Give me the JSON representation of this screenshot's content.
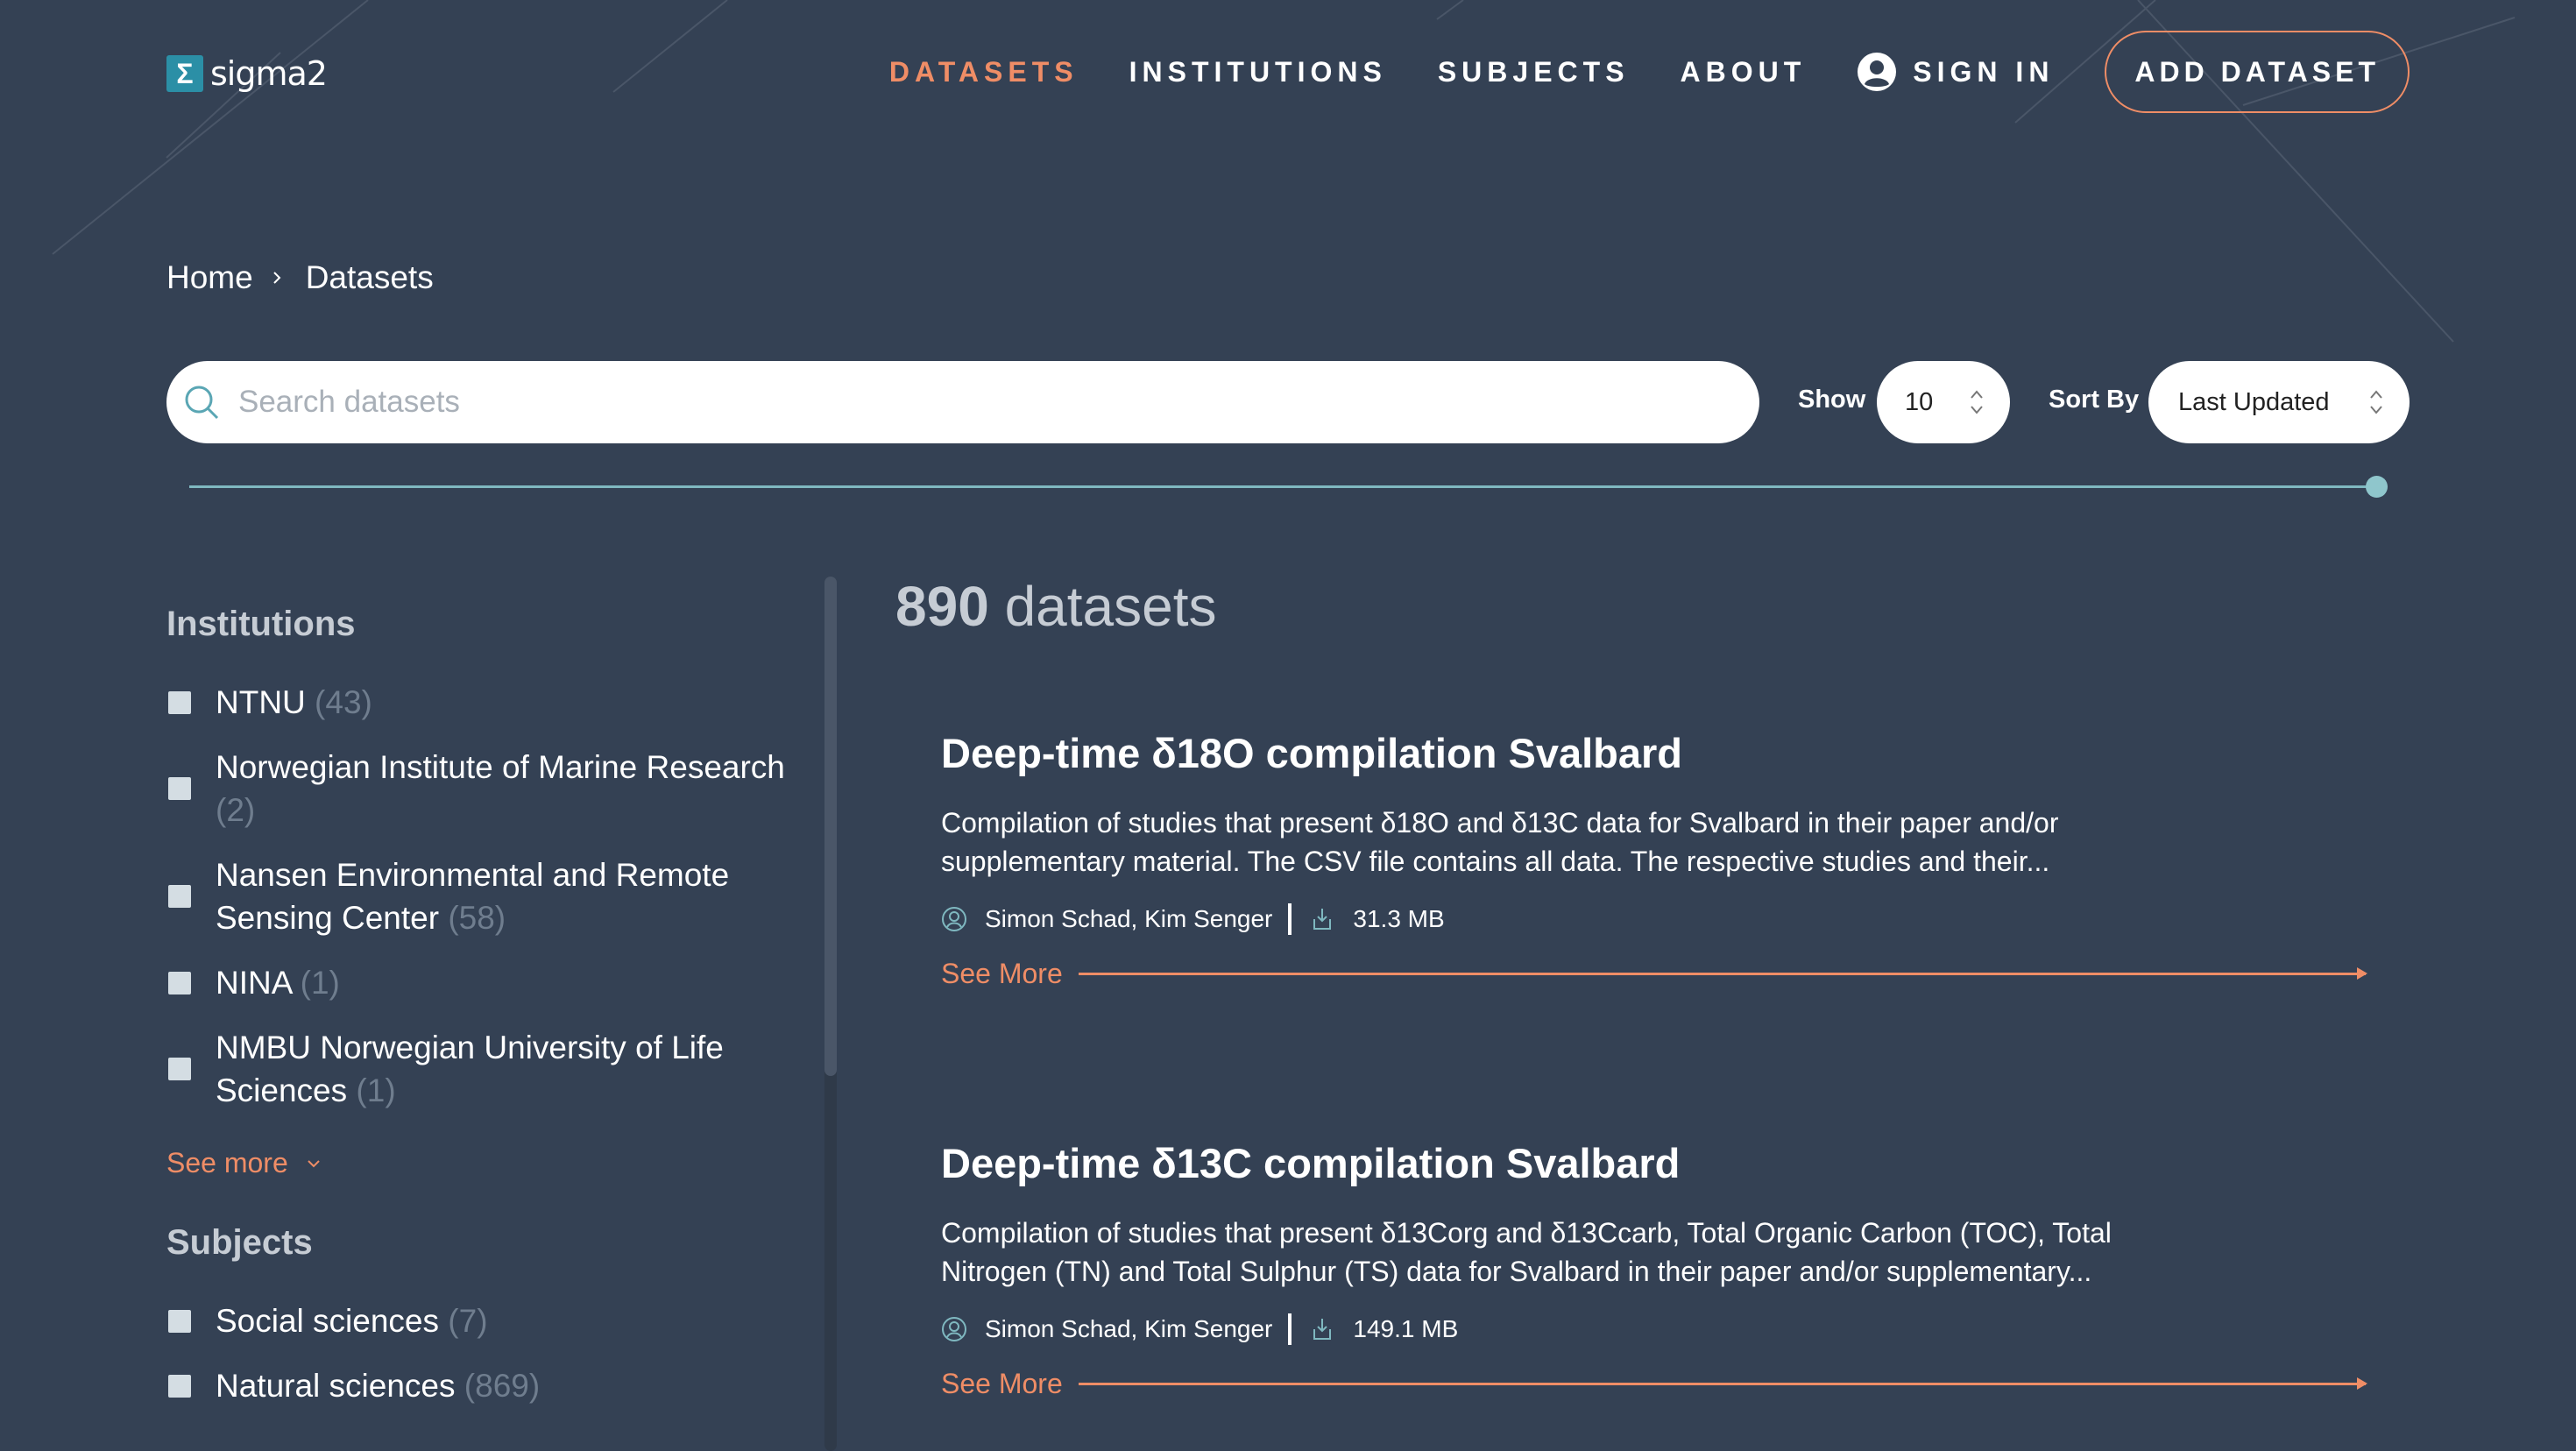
{
  "brand": {
    "logo_glyph": "Σ",
    "name": "sigma2"
  },
  "nav": {
    "items": [
      {
        "label": "DATASETS",
        "active": true
      },
      {
        "label": "INSTITUTIONS"
      },
      {
        "label": "SUBJECTS"
      },
      {
        "label": "ABOUT"
      },
      {
        "label": "SIGN IN",
        "icon": "user-circle-icon"
      }
    ],
    "cta_label": "ADD DATASET"
  },
  "breadcrumb": {
    "home": "Home",
    "current": "Datasets"
  },
  "search": {
    "placeholder": "Search datasets",
    "value": ""
  },
  "show": {
    "label": "Show",
    "value": "10"
  },
  "sort": {
    "label": "Sort By",
    "value": "Last Updated"
  },
  "sidebar": {
    "institutions": {
      "title": "Institutions",
      "items": [
        {
          "label": "NTNU",
          "count": "(43)"
        },
        {
          "label": "Norwegian Institute of Marine Research",
          "count": "(2)"
        },
        {
          "label": "Nansen Environmental and Remote Sensing Center",
          "count": "(58)"
        },
        {
          "label": "NINA",
          "count": "(1)"
        },
        {
          "label": "NMBU Norwegian University of Life Sciences",
          "count": "(1)"
        }
      ],
      "see_more": "See more"
    },
    "subjects": {
      "title": "Subjects",
      "items": [
        {
          "label": "Social sciences",
          "count": "(7)"
        },
        {
          "label": "Natural sciences",
          "count": "(869)"
        }
      ]
    }
  },
  "results": {
    "count": "890",
    "unit": "datasets"
  },
  "datasets": [
    {
      "title": "Deep-time δ18O compilation Svalbard",
      "description": "Compilation of studies that present δ18O and δ13C data for Svalbard in their paper and/or supplementary material. The CSV file contains all data. The respective studies and their...",
      "authors": "Simon Schad, Kim Senger",
      "size": "31.3 MB",
      "see_more": "See More"
    },
    {
      "title": "Deep-time δ13C compilation Svalbard",
      "description": "Compilation of studies that present δ13Corg and δ13Ccarb, Total Organic Carbon (TOC), Total Nitrogen (TN) and Total Sulphur (TS) data for Svalbard in their paper and/or supplementary...",
      "authors": "Simon Schad, Kim Senger",
      "size": "149.1 MB",
      "see_more": "See More"
    }
  ],
  "colors": {
    "background": "#344154",
    "accent": "#ef8d66",
    "slider": "#8fc6cc"
  }
}
